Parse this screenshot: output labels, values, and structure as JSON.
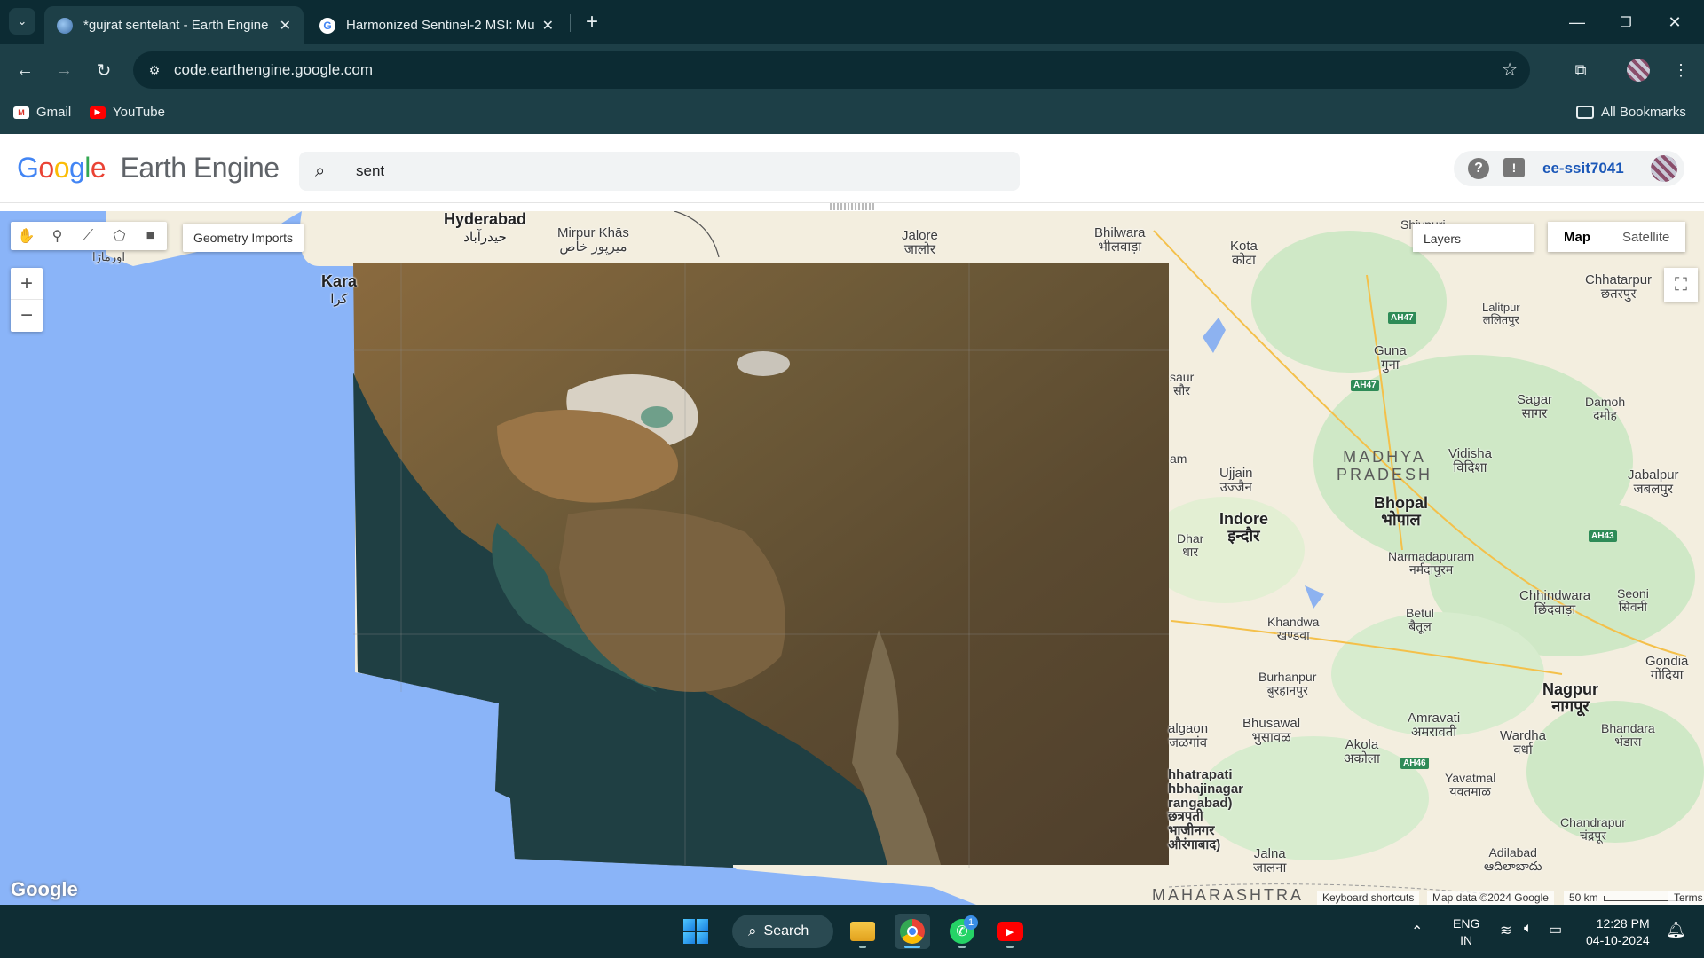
{
  "browser": {
    "tabs": [
      {
        "title": "*gujrat sentelant - Earth Engine",
        "active": true
      },
      {
        "title": "Harmonized Sentinel-2 MSI: Mu",
        "active": false
      }
    ],
    "url": "code.earthengine.google.com",
    "bookmarks": [
      "Gmail",
      "YouTube"
    ],
    "all_bookmarks": "All Bookmarks"
  },
  "ee": {
    "logo_google": "Google",
    "logo_product": "Earth Engine",
    "search_value": "sent",
    "help_glyph": "?",
    "feedback_glyph": "!",
    "account": "ee-ssit7041"
  },
  "map": {
    "geometry_imports": "Geometry Imports",
    "layers_label": "Layers",
    "map_types": [
      "Map",
      "Satellite"
    ],
    "active_map_type": "Map",
    "google_logo": "Google",
    "keyboard_shortcuts": "Keyboard shortcuts",
    "map_data": "Map data ©2024 Google",
    "scale": "50 km",
    "terms": "Terms",
    "cities": {
      "hyderabad": "Hyderabad",
      "hyderabad_local": "حیدرآباد",
      "mirpur": "Mirpur Khās",
      "mirpur_local": "میرپور خاص",
      "jalore": "Jalore",
      "jalore_local": "जालोर",
      "bhilwara": "Bhilwara",
      "bhilwara_local": "भीलवाड़ा",
      "kota": "Kota",
      "kota_local": "कोटा",
      "karachi": "Kara",
      "karachi_local": "کرا",
      "ormara": "اورماڑا",
      "shivpuri": "Shivpuri",
      "chhatarpur": "Chhatarpur",
      "chhatarpur_local": "छतरपुर",
      "lalitpur": "Lalitpur",
      "lalitpur_local": "ललितपुर",
      "guna": "Guna",
      "guna_local": "गुना",
      "sagar": "Sagar",
      "sagar_local": "सागर",
      "damoh": "Damoh",
      "damoh_local": "दमोह",
      "vidisha": "Vidisha",
      "vidisha_local": "विदिशा",
      "ujjain": "Ujjain",
      "ujjain_local": "उज्जैन",
      "bhopal": "Bhopal",
      "bhopal_local": "भोपाल",
      "indore": "Indore",
      "indore_local": "इन्दौर",
      "jabalpur": "Jabalpur",
      "jabalpur_local": "जबलपुर",
      "dhar": "Dhar",
      "dhar_local": "धार",
      "narmadapuram": "Narmadapuram",
      "narmadapuram_local": "नर्मदापुरम",
      "khandwa": "Khandwa",
      "khandwa_local": "खण्डवा",
      "betul": "Betul",
      "betul_local": "बैतूल",
      "chhindwara": "Chhindwara",
      "chhindwara_local": "छिंदवाड़ा",
      "seoni": "Seoni",
      "seoni_local": "सिवनी",
      "burhanpur": "Burhanpur",
      "burhanpur_local": "बुरहानपुर",
      "nagpur": "Nagpur",
      "nagpur_local": "नागपूर",
      "gondia": "Gondia",
      "gondia_local": "गोंदिया",
      "bhusawal": "Bhusawal",
      "bhusawal_local": "भुसावळ",
      "jalgaon": "algaon",
      "jalgaon_local": "जळगांव",
      "amravati": "Amravati",
      "amravati_local": "अमरावती",
      "akola": "Akola",
      "akola_local": "अकोला",
      "wardha": "Wardha",
      "wardha_local": "वर्धा",
      "bhandara": "Bhandara",
      "bhandara_local": "भंडारा",
      "yavatmal": "Yavatmal",
      "yavatmal_local": "यवतमाळ",
      "aurangabad": "hhatrapati\nhbhajinagar\nrangabad)\nछत्रपती\nभाजीनगर\nऔरंगाबाद)",
      "jalna": "Jalna",
      "jalna_local": "जालना",
      "chandrapur": "Chandrapur",
      "chandrapur_local": "चंद्रपूर",
      "adilabad": "Adilabad",
      "adilabad_local": "ఆదిలాబాదు",
      "mandsaur": "saur",
      "mandsaur_local": "सौर",
      "ratlam": "am"
    },
    "regions": {
      "madhya_pradesh": "MADHYA\nPRADESH",
      "maharashtra": "MAHARASHTRA"
    },
    "highways": [
      "AH47",
      "AH47",
      "AH43",
      "AH46"
    ]
  },
  "taskbar": {
    "search_label": "Search",
    "whatsapp_badge": "1",
    "lang": "ENG",
    "region": "IN",
    "time": "12:28 PM",
    "date": "04-10-2024"
  }
}
